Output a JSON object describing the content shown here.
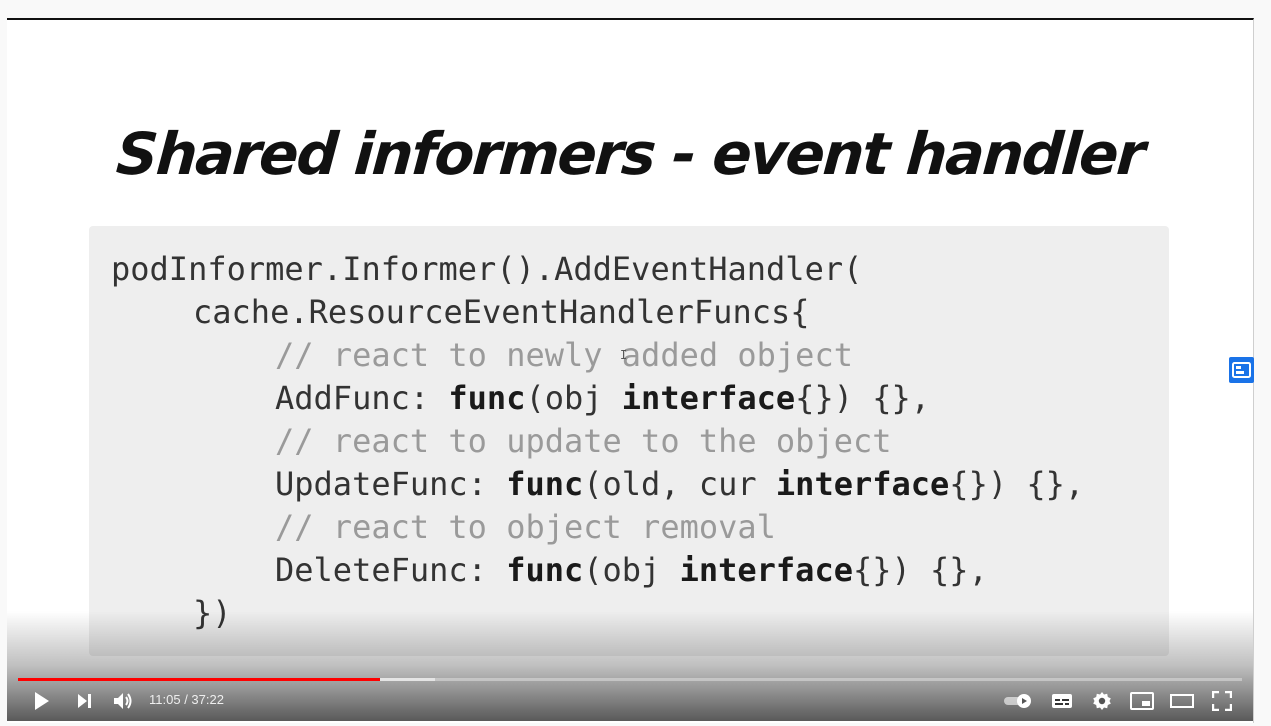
{
  "slide": {
    "title": "Shared informers - event handler",
    "code": [
      {
        "indent": 0,
        "type": "code",
        "parts": [
          {
            "t": "podInformer.Informer().AddEventHandler("
          }
        ]
      },
      {
        "indent": 1,
        "type": "code",
        "parts": [
          {
            "t": "cache.ResourceEventHandlerFuncs{"
          }
        ]
      },
      {
        "indent": 2,
        "type": "comment",
        "parts": [
          {
            "t": "// react to newly added object"
          }
        ]
      },
      {
        "indent": 2,
        "type": "code",
        "parts": [
          {
            "t": "AddFunc: "
          },
          {
            "t": "func",
            "kw": true
          },
          {
            "t": "(obj "
          },
          {
            "t": "interface",
            "kw": true
          },
          {
            "t": "{}) {},"
          }
        ]
      },
      {
        "indent": 2,
        "type": "comment",
        "parts": [
          {
            "t": "// react to update to the object"
          }
        ]
      },
      {
        "indent": 2,
        "type": "code",
        "parts": [
          {
            "t": "UpdateFunc: "
          },
          {
            "t": "func",
            "kw": true
          },
          {
            "t": "(old, cur "
          },
          {
            "t": "interface",
            "kw": true
          },
          {
            "t": "{}) {},"
          }
        ]
      },
      {
        "indent": 2,
        "type": "comment",
        "parts": [
          {
            "t": "// react to object removal"
          }
        ]
      },
      {
        "indent": 2,
        "type": "code",
        "parts": [
          {
            "t": "DeleteFunc: "
          },
          {
            "t": "func",
            "kw": true
          },
          {
            "t": "(obj "
          },
          {
            "t": "interface",
            "kw": true
          },
          {
            "t": "{}) {},"
          }
        ]
      },
      {
        "indent": 1,
        "type": "code",
        "parts": [
          {
            "t": "})"
          }
        ]
      }
    ]
  },
  "player": {
    "time_current": "11:05",
    "time_total": "37:22",
    "time_separator": " / ",
    "progress_played": 0.296,
    "progress_buffered": 0.341,
    "accent_color": "#ff0000",
    "side_icon": "chapter-panel-icon",
    "controls": {
      "play": "play-icon",
      "next": "next-icon",
      "volume": "volume-icon",
      "autoplay": "autoplay-toggle-icon",
      "subtitles": "subtitles-icon",
      "settings": "gear-icon",
      "miniplayer": "miniplayer-icon",
      "theater": "theater-mode-icon",
      "fullscreen": "fullscreen-icon"
    }
  }
}
